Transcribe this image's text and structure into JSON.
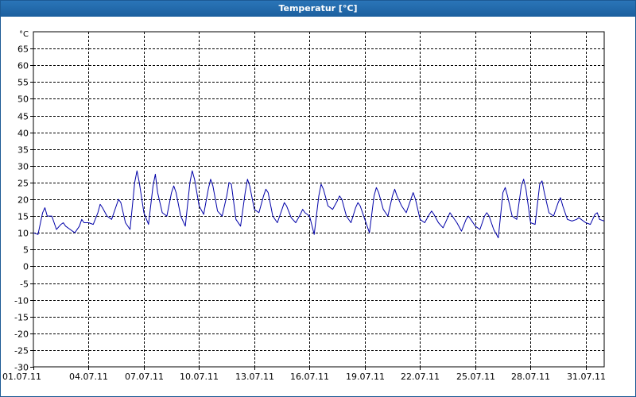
{
  "window": {
    "title": "Temperatur [°C]"
  },
  "colors": {
    "title_bar": "#1c5f9e",
    "grid": "#000000",
    "series": "#0000a8"
  },
  "chart_data": {
    "type": "line",
    "title": "Temperatur [°C]",
    "ylabel": "°C",
    "xlabel": "",
    "ylim": [
      -30,
      70
    ],
    "y_ticks": [
      -30,
      -25,
      -20,
      -15,
      -10,
      -5,
      0,
      5,
      10,
      15,
      20,
      25,
      30,
      35,
      40,
      45,
      50,
      55,
      60,
      65
    ],
    "x_range": [
      "2011-07-01T00:00",
      "2011-08-01T00:00"
    ],
    "x_tick_labels": [
      "01.07.11",
      "04.07.11",
      "07.07.11",
      "10.07.11",
      "13.07.11",
      "16.07.11",
      "19.07.11",
      "22.07.11",
      "25.07.11",
      "28.07.11",
      "31.07.11"
    ],
    "grid": true,
    "grid_style": "dashed",
    "legend": "none",
    "series": [
      {
        "points": [
          [
            "2011-07-01T00:00",
            10.0
          ],
          [
            "2011-07-01T06:00",
            9.5
          ],
          [
            "2011-07-01T12:00",
            16.0
          ],
          [
            "2011-07-01T15:00",
            17.5
          ],
          [
            "2011-07-01T18:00",
            15.0
          ],
          [
            "2011-07-02T00:00",
            15.0
          ],
          [
            "2011-07-02T06:00",
            11.0
          ],
          [
            "2011-07-02T12:00",
            12.5
          ],
          [
            "2011-07-02T15:00",
            13.0
          ],
          [
            "2011-07-02T18:00",
            12.0
          ],
          [
            "2011-07-03T00:00",
            11.0
          ],
          [
            "2011-07-03T06:00",
            10.0
          ],
          [
            "2011-07-03T12:00",
            12.0
          ],
          [
            "2011-07-03T15:00",
            14.0
          ],
          [
            "2011-07-03T18:00",
            13.0
          ],
          [
            "2011-07-04T00:00",
            13.0
          ],
          [
            "2011-07-04T06:00",
            12.5
          ],
          [
            "2011-07-04T12:00",
            16.0
          ],
          [
            "2011-07-04T15:00",
            18.5
          ],
          [
            "2011-07-04T18:00",
            17.5
          ],
          [
            "2011-07-05T00:00",
            15.0
          ],
          [
            "2011-07-05T06:00",
            14.0
          ],
          [
            "2011-07-05T12:00",
            18.0
          ],
          [
            "2011-07-05T15:00",
            20.0
          ],
          [
            "2011-07-05T18:00",
            19.0
          ],
          [
            "2011-07-06T00:00",
            13.0
          ],
          [
            "2011-07-06T06:00",
            11.0
          ],
          [
            "2011-07-06T12:00",
            25.0
          ],
          [
            "2011-07-06T15:00",
            28.5
          ],
          [
            "2011-07-06T18:00",
            25.0
          ],
          [
            "2011-07-07T00:00",
            16.0
          ],
          [
            "2011-07-07T06:00",
            12.5
          ],
          [
            "2011-07-07T12:00",
            24.0
          ],
          [
            "2011-07-07T15:00",
            27.5
          ],
          [
            "2011-07-07T18:00",
            22.0
          ],
          [
            "2011-07-08T00:00",
            16.0
          ],
          [
            "2011-07-08T06:00",
            15.0
          ],
          [
            "2011-07-08T12:00",
            22.0
          ],
          [
            "2011-07-08T15:00",
            24.0
          ],
          [
            "2011-07-08T18:00",
            22.0
          ],
          [
            "2011-07-09T00:00",
            15.0
          ],
          [
            "2011-07-09T06:00",
            12.0
          ],
          [
            "2011-07-09T12:00",
            25.0
          ],
          [
            "2011-07-09T15:00",
            28.5
          ],
          [
            "2011-07-09T18:00",
            26.0
          ],
          [
            "2011-07-10T00:00",
            18.0
          ],
          [
            "2011-07-10T06:00",
            15.5
          ],
          [
            "2011-07-10T12:00",
            23.0
          ],
          [
            "2011-07-10T15:00",
            26.0
          ],
          [
            "2011-07-10T18:00",
            24.0
          ],
          [
            "2011-07-11T00:00",
            16.5
          ],
          [
            "2011-07-11T06:00",
            15.0
          ],
          [
            "2011-07-11T12:00",
            21.0
          ],
          [
            "2011-07-11T15:00",
            25.0
          ],
          [
            "2011-07-11T18:00",
            24.5
          ],
          [
            "2011-07-12T00:00",
            14.0
          ],
          [
            "2011-07-12T06:00",
            12.0
          ],
          [
            "2011-07-12T12:00",
            22.0
          ],
          [
            "2011-07-12T15:00",
            26.0
          ],
          [
            "2011-07-12T18:00",
            24.0
          ],
          [
            "2011-07-13T00:00",
            17.0
          ],
          [
            "2011-07-13T06:00",
            16.0
          ],
          [
            "2011-07-13T12:00",
            21.0
          ],
          [
            "2011-07-13T15:00",
            23.0
          ],
          [
            "2011-07-13T18:00",
            22.0
          ],
          [
            "2011-07-14T00:00",
            15.0
          ],
          [
            "2011-07-14T06:00",
            13.0
          ],
          [
            "2011-07-14T12:00",
            17.0
          ],
          [
            "2011-07-14T15:00",
            19.0
          ],
          [
            "2011-07-14T18:00",
            18.0
          ],
          [
            "2011-07-15T00:00",
            14.5
          ],
          [
            "2011-07-15T06:00",
            13.0
          ],
          [
            "2011-07-15T12:00",
            15.5
          ],
          [
            "2011-07-15T15:00",
            17.0
          ],
          [
            "2011-07-15T18:00",
            16.0
          ],
          [
            "2011-07-16T00:00",
            15.0
          ],
          [
            "2011-07-16T06:00",
            9.5
          ],
          [
            "2011-07-16T12:00",
            21.0
          ],
          [
            "2011-07-16T15:00",
            24.5
          ],
          [
            "2011-07-16T18:00",
            23.0
          ],
          [
            "2011-07-17T00:00",
            18.0
          ],
          [
            "2011-07-17T06:00",
            17.0
          ],
          [
            "2011-07-17T12:00",
            19.5
          ],
          [
            "2011-07-17T15:00",
            21.0
          ],
          [
            "2011-07-17T18:00",
            20.0
          ],
          [
            "2011-07-18T00:00",
            15.0
          ],
          [
            "2011-07-18T06:00",
            13.0
          ],
          [
            "2011-07-18T12:00",
            17.5
          ],
          [
            "2011-07-18T15:00",
            19.0
          ],
          [
            "2011-07-18T18:00",
            18.0
          ],
          [
            "2011-07-19T00:00",
            14.0
          ],
          [
            "2011-07-19T06:00",
            10.0
          ],
          [
            "2011-07-19T12:00",
            21.0
          ],
          [
            "2011-07-19T15:00",
            23.5
          ],
          [
            "2011-07-19T18:00",
            22.0
          ],
          [
            "2011-07-20T00:00",
            17.0
          ],
          [
            "2011-07-20T06:00",
            15.0
          ],
          [
            "2011-07-20T12:00",
            21.0
          ],
          [
            "2011-07-20T15:00",
            23.0
          ],
          [
            "2011-07-20T18:00",
            21.0
          ],
          [
            "2011-07-21T00:00",
            18.0
          ],
          [
            "2011-07-21T06:00",
            16.0
          ],
          [
            "2011-07-21T12:00",
            20.0
          ],
          [
            "2011-07-21T15:00",
            22.0
          ],
          [
            "2011-07-21T18:00",
            20.0
          ],
          [
            "2011-07-22T00:00",
            14.0
          ],
          [
            "2011-07-22T06:00",
            13.0
          ],
          [
            "2011-07-22T12:00",
            15.5
          ],
          [
            "2011-07-22T15:00",
            16.5
          ],
          [
            "2011-07-22T18:00",
            15.5
          ],
          [
            "2011-07-23T00:00",
            13.0
          ],
          [
            "2011-07-23T06:00",
            11.5
          ],
          [
            "2011-07-23T12:00",
            14.5
          ],
          [
            "2011-07-23T15:00",
            16.0
          ],
          [
            "2011-07-23T18:00",
            15.0
          ],
          [
            "2011-07-24T00:00",
            13.0
          ],
          [
            "2011-07-24T06:00",
            10.5
          ],
          [
            "2011-07-24T12:00",
            14.0
          ],
          [
            "2011-07-24T15:00",
            15.0
          ],
          [
            "2011-07-24T18:00",
            14.0
          ],
          [
            "2011-07-25T00:00",
            12.0
          ],
          [
            "2011-07-25T06:00",
            11.0
          ],
          [
            "2011-07-25T12:00",
            15.0
          ],
          [
            "2011-07-25T15:00",
            16.0
          ],
          [
            "2011-07-25T18:00",
            15.0
          ],
          [
            "2011-07-26T00:00",
            11.0
          ],
          [
            "2011-07-26T06:00",
            8.5
          ],
          [
            "2011-07-26T12:00",
            22.0
          ],
          [
            "2011-07-26T15:00",
            23.5
          ],
          [
            "2011-07-26T18:00",
            21.0
          ],
          [
            "2011-07-27T00:00",
            15.0
          ],
          [
            "2011-07-27T06:00",
            14.0
          ],
          [
            "2011-07-27T12:00",
            24.0
          ],
          [
            "2011-07-27T15:00",
            26.0
          ],
          [
            "2011-07-27T18:00",
            23.0
          ],
          [
            "2011-07-28T00:00",
            13.0
          ],
          [
            "2011-07-28T06:00",
            12.5
          ],
          [
            "2011-07-28T12:00",
            24.5
          ],
          [
            "2011-07-28T15:00",
            25.5
          ],
          [
            "2011-07-28T18:00",
            22.0
          ],
          [
            "2011-07-29T00:00",
            16.0
          ],
          [
            "2011-07-29T06:00",
            15.0
          ],
          [
            "2011-07-29T12:00",
            19.0
          ],
          [
            "2011-07-29T15:00",
            20.5
          ],
          [
            "2011-07-29T18:00",
            18.0
          ],
          [
            "2011-07-30T00:00",
            14.0
          ],
          [
            "2011-07-30T06:00",
            13.5
          ],
          [
            "2011-07-30T12:00",
            14.0
          ],
          [
            "2011-07-30T15:00",
            14.5
          ],
          [
            "2011-07-30T18:00",
            14.0
          ],
          [
            "2011-07-31T00:00",
            13.0
          ],
          [
            "2011-07-31T06:00",
            12.5
          ],
          [
            "2011-07-31T12:00",
            15.5
          ],
          [
            "2011-07-31T15:00",
            16.0
          ],
          [
            "2011-07-31T18:00",
            14.0
          ],
          [
            "2011-08-01T00:00",
            13.5
          ]
        ]
      }
    ]
  }
}
